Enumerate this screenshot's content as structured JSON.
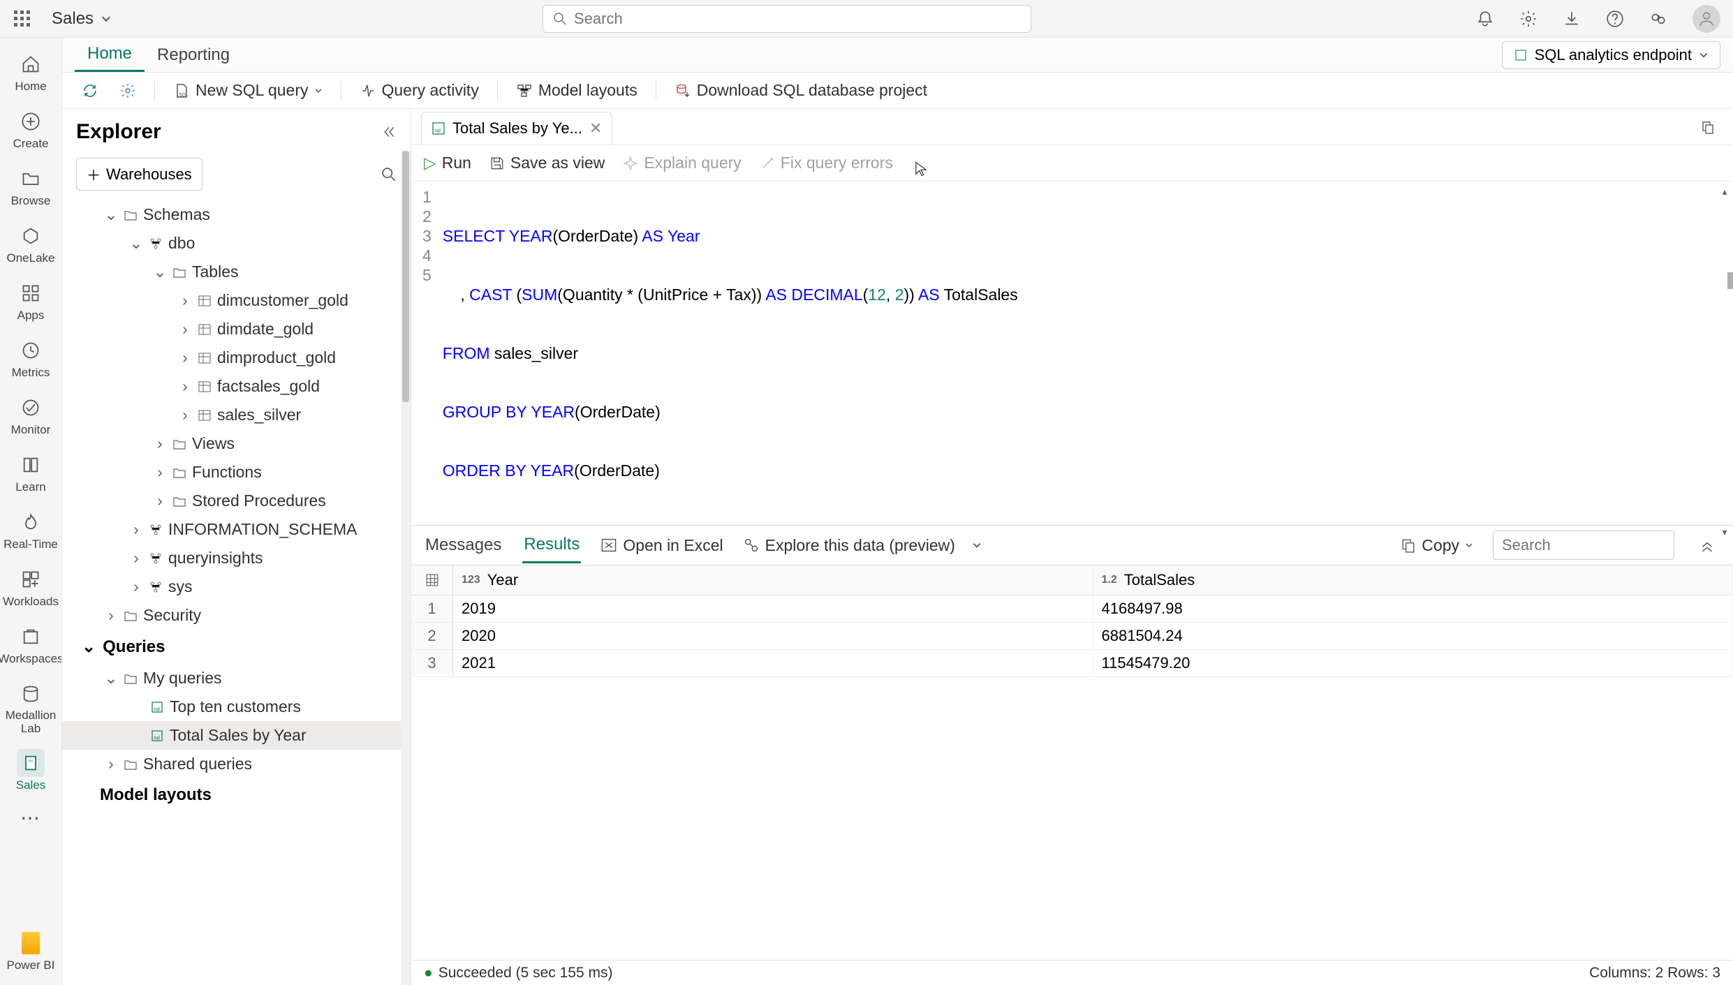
{
  "header": {
    "workspace": "Sales",
    "search_placeholder": "Search"
  },
  "nav_rail": {
    "items": [
      {
        "label": "Home"
      },
      {
        "label": "Create"
      },
      {
        "label": "Browse"
      },
      {
        "label": "OneLake"
      },
      {
        "label": "Apps"
      },
      {
        "label": "Metrics"
      },
      {
        "label": "Monitor"
      },
      {
        "label": "Learn"
      },
      {
        "label": "Real-Time"
      },
      {
        "label": "Workloads"
      },
      {
        "label": "Workspaces"
      },
      {
        "label": "Medallion Lab"
      },
      {
        "label": "Sales"
      }
    ],
    "bottom": "Power BI"
  },
  "tabs": {
    "home": "Home",
    "reporting": "Reporting",
    "endpoint": "SQL analytics endpoint"
  },
  "toolbar": {
    "new_query": "New SQL query",
    "query_activity": "Query activity",
    "model_layouts": "Model layouts",
    "download": "Download SQL database project"
  },
  "explorer": {
    "title": "Explorer",
    "warehouses": "Warehouses",
    "schemas": "Schemas",
    "dbo": "dbo",
    "tables": "Tables",
    "tables_list": [
      "dimcustomer_gold",
      "dimdate_gold",
      "dimproduct_gold",
      "factsales_gold",
      "sales_silver"
    ],
    "views": "Views",
    "functions": "Functions",
    "stored_procedures": "Stored Procedures",
    "information_schema": "INFORMATION_SCHEMA",
    "queryinsights": "queryinsights",
    "sys": "sys",
    "security": "Security",
    "queries": "Queries",
    "my_queries": "My queries",
    "top_ten": "Top ten customers",
    "total_sales": "Total Sales by Year",
    "shared_queries": "Shared queries",
    "model_layouts": "Model layouts"
  },
  "editor": {
    "tab_name": "Total Sales by Ye...",
    "run": "Run",
    "save_as_view": "Save as view",
    "explain": "Explain query",
    "fix": "Fix query errors",
    "sql_lines": [
      "SELECT YEAR(OrderDate) AS Year",
      "    , CAST (SUM(Quantity * (UnitPrice + Tax)) AS DECIMAL(12, 2)) AS TotalSales",
      "FROM sales_silver",
      "GROUP BY YEAR(OrderDate)",
      "ORDER BY YEAR(OrderDate)"
    ]
  },
  "results": {
    "messages": "Messages",
    "results": "Results",
    "open_excel": "Open in Excel",
    "explore": "Explore this data (preview)",
    "copy": "Copy",
    "search_placeholder": "Search",
    "col1": "Year",
    "col2": "TotalSales",
    "rows": [
      {
        "n": "1",
        "year": "2019",
        "total": "4168497.98"
      },
      {
        "n": "2",
        "year": "2020",
        "total": "6881504.24"
      },
      {
        "n": "3",
        "year": "2021",
        "total": "11545479.20"
      }
    ]
  },
  "status": {
    "message": "Succeeded (5 sec 155 ms)",
    "columns": "Columns: 2 Rows: 3"
  }
}
